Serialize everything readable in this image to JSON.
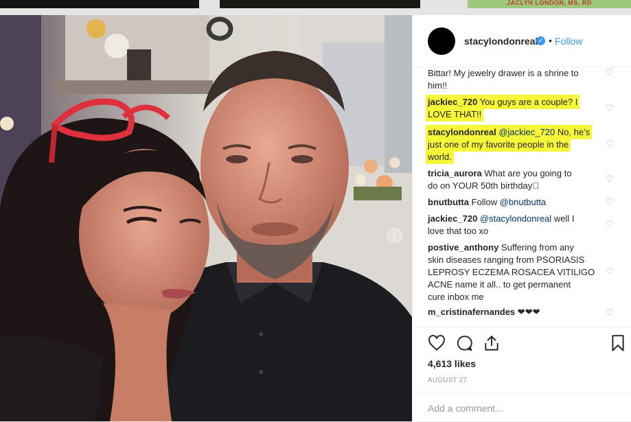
{
  "top_strip": {
    "ad_text": "JACLYN LONDON, MS, RD"
  },
  "post": {
    "username": "stacylondonreal",
    "verified_mark": "✓",
    "separator": "•",
    "follow_label": "Follow",
    "carousel_next": "›",
    "carousel": {
      "count": 3,
      "active": 1
    }
  },
  "comments": [
    {
      "user": "",
      "text": "Bittar! My jewelry drawer is a shrine to him!!",
      "line1": "Bittar! My jewelry drawer is a shrine to",
      "line2": "him!!"
    },
    {
      "user": "jackiec_720",
      "line1_text": "You guys are a couple? I",
      "line2": "LOVE THAT!!"
    },
    {
      "user": "stacylondonreal",
      "mention": "@jackiec_720",
      "line1_text": "No, he’s",
      "line2": "just one of my favorite people in the",
      "line3": "world."
    },
    {
      "user": "tricia_aurora",
      "line1_text": "What are you going to",
      "line2": "do on YOUR 50th birthday\u0000"
    },
    {
      "user": "bnutbutta",
      "line1_text": "Follow",
      "mention": "@bnutbutta"
    },
    {
      "user": "jackiec_720",
      "mention": "@stacylondonreal",
      "line1_text": "well I",
      "line2": "love that too xo"
    },
    {
      "user": "postive_anthony",
      "line1_text": "Suffering from any",
      "line2": "skin diseases ranging from PSORIASIS",
      "line3": "LEPROSY ECZEMA ROSACEA VITILIGO",
      "line4": "ACNE name it all.. to get permanent",
      "line5": "cure inbox me"
    },
    {
      "user": "m_cristinafernandes",
      "line1_text": "❤❤❤"
    }
  ],
  "likes": "4,613 likes",
  "date": "AUGUST 27",
  "add_comment_placeholder": "Add a comment...",
  "icons": [
    "heart-icon",
    "comment-icon",
    "share-icon",
    "bookmark-icon",
    "like-comment-icon"
  ],
  "colors": {
    "highlight": "#f7f73a",
    "link": "#3897f0",
    "muted": "#999999",
    "text": "#262626"
  }
}
